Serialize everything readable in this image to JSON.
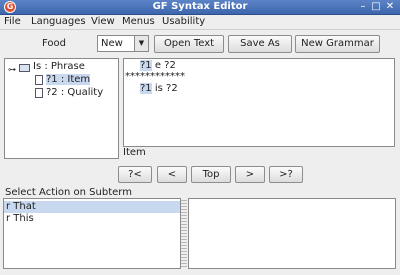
{
  "window": {
    "title": "GF Syntax Editor",
    "icon_label": "G",
    "controls": [
      "–",
      "□",
      "✕"
    ]
  },
  "menubar": {
    "items": [
      "File",
      "Languages",
      "View",
      "Menus",
      "Usability"
    ]
  },
  "toolbar": {
    "language_label": "Food",
    "mode_value": "New",
    "open_text": "Open Text",
    "save_as": "Save As",
    "new_grammar": "New Grammar"
  },
  "tree": {
    "root": "Is : Phrase",
    "children": [
      {
        "label": "?1 : Item",
        "selected": true
      },
      {
        "label": "?2 : Quality",
        "selected": false
      }
    ]
  },
  "editor": {
    "line1_meta": "?1",
    "line1_rest": " e ?2",
    "separator": "************",
    "line2_meta": "?1",
    "line2_rest": " is ?2"
  },
  "status": {
    "text": "Item"
  },
  "navigation": {
    "buttons": [
      "?<",
      "<",
      "Top",
      ">",
      ">?"
    ]
  },
  "actions": {
    "caption": "Select Action on Subterm",
    "items": [
      {
        "label": "r That",
        "selected": true
      },
      {
        "label": "r This",
        "selected": false
      }
    ]
  },
  "colors": {
    "titlebar": "#4a72b8",
    "selection": "#c8d8ef"
  }
}
